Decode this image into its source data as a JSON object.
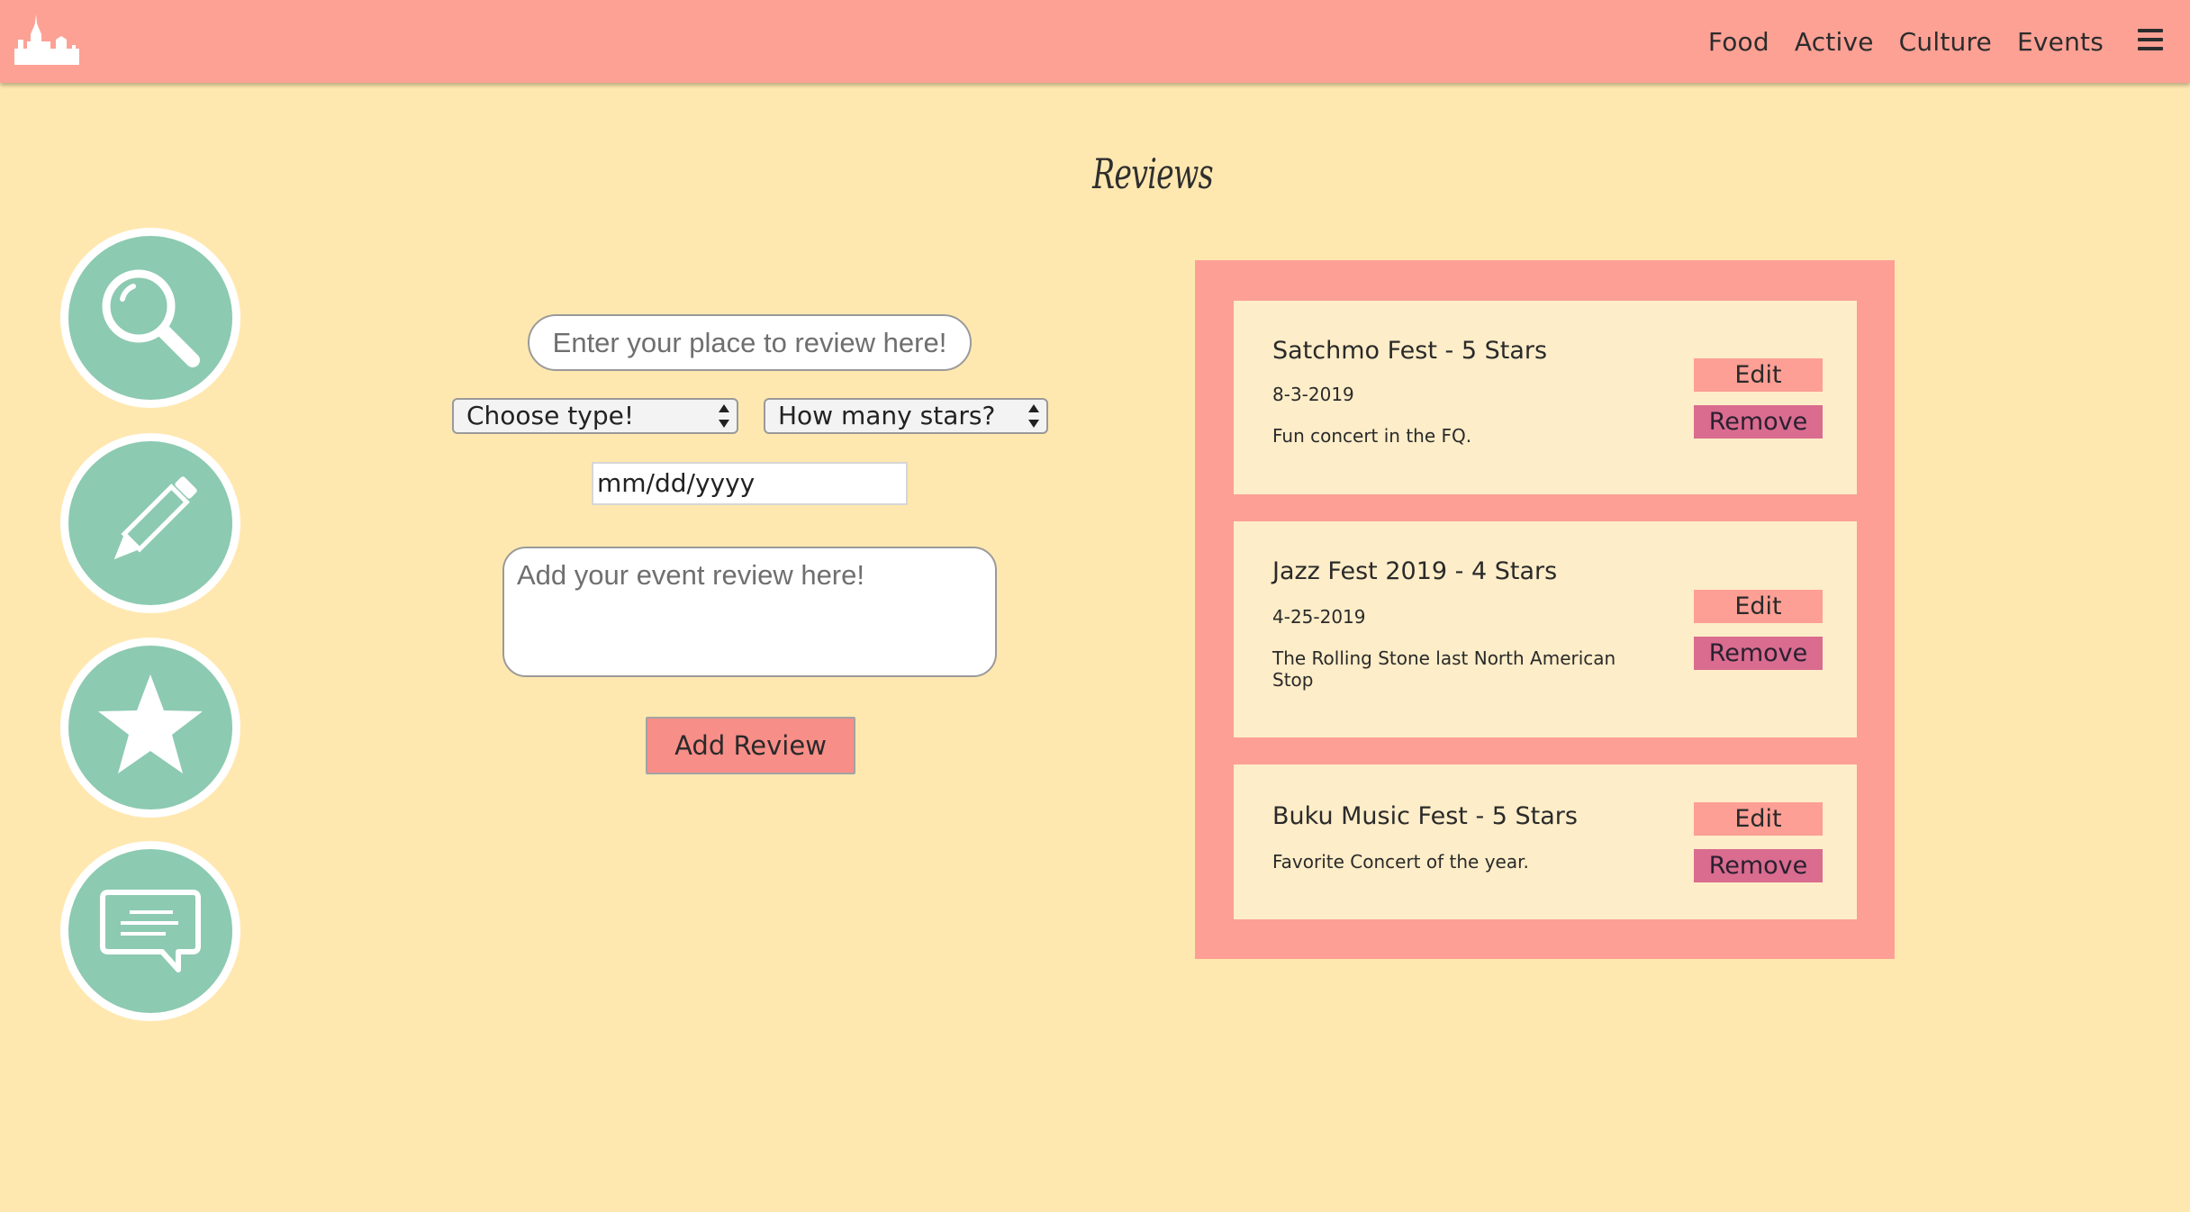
{
  "nav": {
    "links": [
      "Food",
      "Active",
      "Culture",
      "Events"
    ]
  },
  "page": {
    "title": "Reviews"
  },
  "sidebar": {
    "buttons": [
      "search-icon",
      "pencil-icon",
      "star-icon",
      "chat-icon"
    ]
  },
  "form": {
    "place_placeholder": "Enter your place to review here!",
    "type_select": "Choose type!",
    "stars_select": "How many stars?",
    "date_value": "mm/dd/yyyy",
    "review_placeholder": "Add your event review here!",
    "submit_label": "Add Review"
  },
  "reviews": [
    {
      "title": "Satchmo Fest - 5 Stars",
      "date": "8-3-2019",
      "body": "Fun concert in the FQ.",
      "edit_label": "Edit",
      "remove_label": "Remove"
    },
    {
      "title": "Jazz Fest 2019 - 4 Stars",
      "date": "4-25-2019",
      "body": "The Rolling Stone last North American Stop",
      "edit_label": "Edit",
      "remove_label": "Remove"
    },
    {
      "title": "Buku Music Fest - 5 Stars",
      "body": "Favorite Concert of the year.",
      "edit_label": "Edit",
      "remove_label": "Remove"
    }
  ],
  "colors": {
    "background": "#ffe8b0",
    "navbar": "#fda195",
    "sidebar_button": "#8ccab1",
    "card": "#fdedc8",
    "edit_button": "#fd9f94",
    "remove_button": "#d96c8f"
  }
}
